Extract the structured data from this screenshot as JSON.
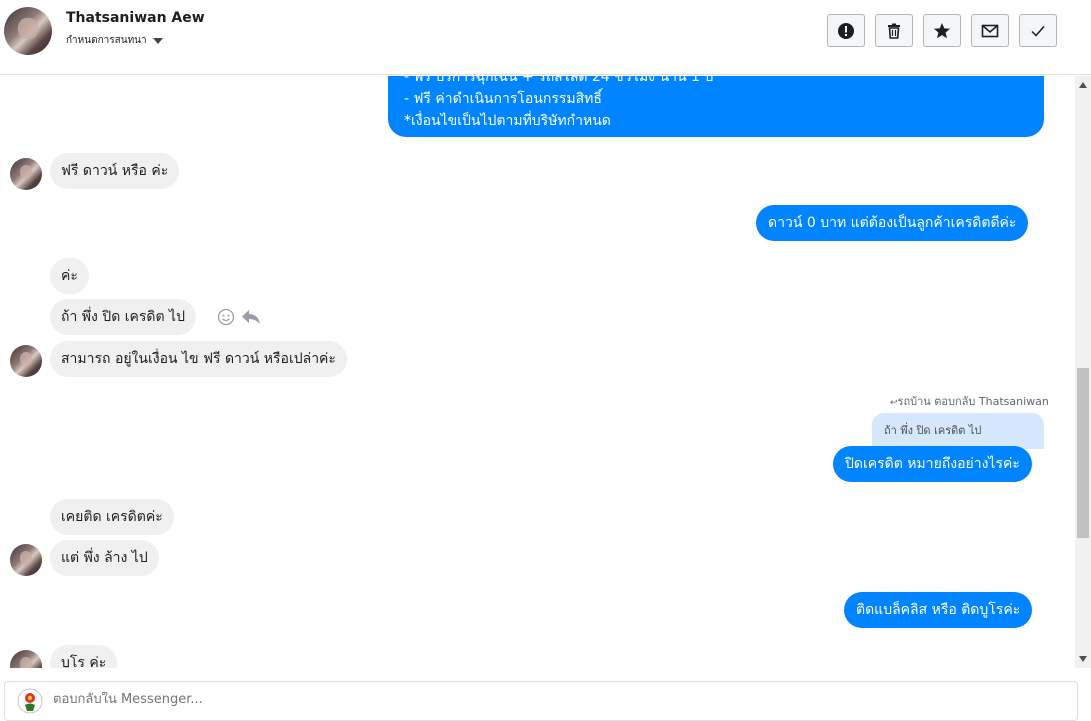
{
  "header": {
    "name": "Thatsaniwan Aew",
    "subtitle": "กำหนดการสนทนา",
    "buttons": [
      {
        "icon": "alert-icon"
      },
      {
        "icon": "trash-icon"
      },
      {
        "icon": "star-icon"
      },
      {
        "icon": "mail-icon"
      },
      {
        "icon": "check-icon"
      }
    ]
  },
  "messages": {
    "outgoing_top_lines": [
      " - ฟรี บริการฉุกเฉิน + รถสไลด์ 24 ชั่วโมง นาน 1 ปี",
      " - ฟรี ค่าดำเนินการโอนกรรมสิทธิ์",
      "*เงื่อนไขเป็นไปตามที่บริษัทกำหนด"
    ],
    "m1": "ฟรี ดาวน์ หรือ ค่ะ",
    "m2": "ดาวน์ 0 บาท แต่ต้องเป็นลูกค้าเครดิตดีค่ะ",
    "m3": "ค่ะ",
    "m4": "ถ้า พึ่ง ปิด เครดิต ไป",
    "m5": "สามารถ อยู่ในเงื่อน ไข ฟรี ดาวน์ หรือเปล่าค่ะ",
    "reply_info": "รถบ้าน ตอบกลับ Thatsaniwan",
    "reply_quote": "ถ้า พึ่ง ปิด เครดิต ไป",
    "m6": "ปิดเครดิต หมายถึงอย่างไรค่ะ",
    "m7": "เคยติด เครดิตค่ะ",
    "m8": "แต่ พึ่ง ล้าง ไป",
    "m9": "ติดแบล็คลิส หรือ ติดบูโรค่ะ",
    "m10": "บูโร ค่ะ"
  },
  "composer": {
    "placeholder": "ตอบกลับใน Messenger..."
  },
  "colors": {
    "outgoing": "#0084ff",
    "incoming": "#f1f0f0",
    "quote": "#d6e8fd"
  }
}
